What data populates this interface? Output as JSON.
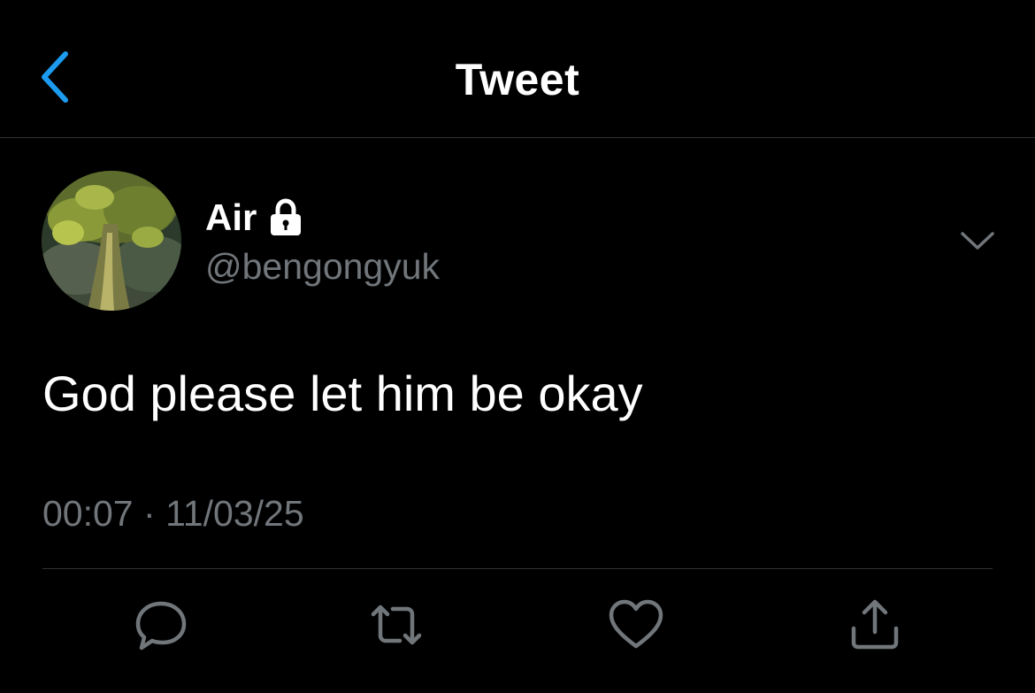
{
  "colors": {
    "background": "#000000",
    "accent": "#1d9bf0",
    "secondary_text": "#71767b",
    "divider": "#2f3336",
    "primary_text": "#ffffff"
  },
  "nav": {
    "title": "Tweet",
    "back_icon": "chevron-left-icon"
  },
  "tweet": {
    "author": {
      "display_name": "Air",
      "protected_icon": "lock-icon",
      "handle": "@bengongyuk",
      "avatar": "avatar-tree-photo"
    },
    "menu_icon": "chevron-down-icon",
    "text": "God please let him be okay",
    "time": "00:07",
    "separator": "·",
    "date": "11/03/25"
  },
  "actions": [
    {
      "name": "reply",
      "icon": "reply-icon"
    },
    {
      "name": "retweet",
      "icon": "retweet-icon"
    },
    {
      "name": "like",
      "icon": "heart-icon"
    },
    {
      "name": "share",
      "icon": "share-icon"
    }
  ]
}
